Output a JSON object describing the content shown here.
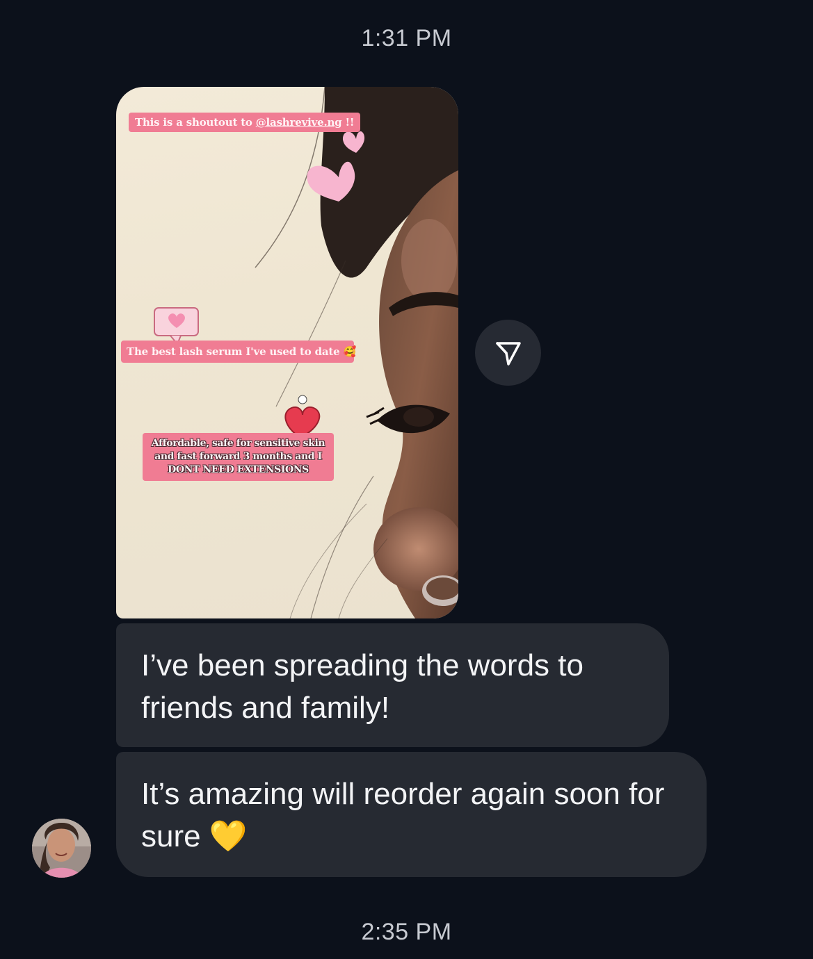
{
  "timestamps": {
    "top": "1:31 PM",
    "bottom": "2:35 PM"
  },
  "story": {
    "sticker_1_prefix": "This is a shoutout to ",
    "sticker_1_handle": "@lashrevive.ng",
    "sticker_1_suffix": " !!",
    "sticker_2": "The best lash serum I've used to date 🥰",
    "sticker_3": "Affordable, safe for sensitive skin and fast forward 3 months and I DONT NEED EXTENSIONS"
  },
  "share_button": {
    "icon": "paper-plane-icon"
  },
  "messages": [
    {
      "text": "I’ve been spreading the words to friends and family!"
    },
    {
      "text": "It’s amazing will reorder again soon for sure 💛"
    }
  ],
  "avatar": {
    "icon": "avatar"
  },
  "colors": {
    "background": "#0c111b",
    "bubble": "#262a32",
    "sticker": "#f07c93",
    "timestamp": "#c7cad1"
  }
}
